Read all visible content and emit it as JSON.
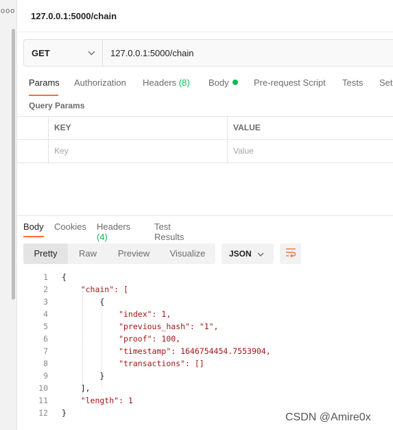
{
  "rail": {
    "menu_dots": "ooo"
  },
  "request": {
    "title": "127.0.0.1:5000/chain",
    "method": "GET",
    "url": "127.0.0.1:5000/chain"
  },
  "request_tabs": [
    {
      "label": "Params",
      "active": true
    },
    {
      "label": "Authorization"
    },
    {
      "label": "Headers",
      "count": "(8)"
    },
    {
      "label": "Body",
      "indicator": "green-dot"
    },
    {
      "label": "Pre-request Script"
    },
    {
      "label": "Tests"
    },
    {
      "label": "Set"
    }
  ],
  "query_params": {
    "title": "Query Params",
    "columns": [
      "KEY",
      "VALUE"
    ],
    "placeholders": {
      "key": "Key",
      "value": "Value"
    }
  },
  "response_tabs": [
    {
      "label": "Body",
      "active": true
    },
    {
      "label": "Cookies"
    },
    {
      "label": "Headers",
      "count": "(4)"
    },
    {
      "label": "Test Results"
    }
  ],
  "response_view": {
    "modes": [
      "Pretty",
      "Raw",
      "Preview",
      "Visualize"
    ],
    "active_mode": "Pretty",
    "format": "JSON",
    "wrap_icon": "wrap-lines-icon"
  },
  "response_body": {
    "lines": [
      {
        "n": "1",
        "text": "{"
      },
      {
        "n": "2",
        "text": "    \"chain\": ["
      },
      {
        "n": "3",
        "text": "        {"
      },
      {
        "n": "4",
        "text": "            \"index\": 1,"
      },
      {
        "n": "5",
        "text": "            \"previous_hash\": \"1\","
      },
      {
        "n": "6",
        "text": "            \"proof\": 100,"
      },
      {
        "n": "7",
        "text": "            \"timestamp\": 1646754454.7553904,"
      },
      {
        "n": "8",
        "text": "            \"transactions\": []"
      },
      {
        "n": "9",
        "text": "        }"
      },
      {
        "n": "10",
        "text": "    ],"
      },
      {
        "n": "11",
        "text": "    \"length\": 1"
      },
      {
        "n": "12",
        "text": "}"
      }
    ]
  },
  "watermark": "CSDN @Amire0x",
  "colors": {
    "accent": "#ff6c37",
    "success": "#0cbb52",
    "key": "#a31515",
    "number": "#098658"
  }
}
